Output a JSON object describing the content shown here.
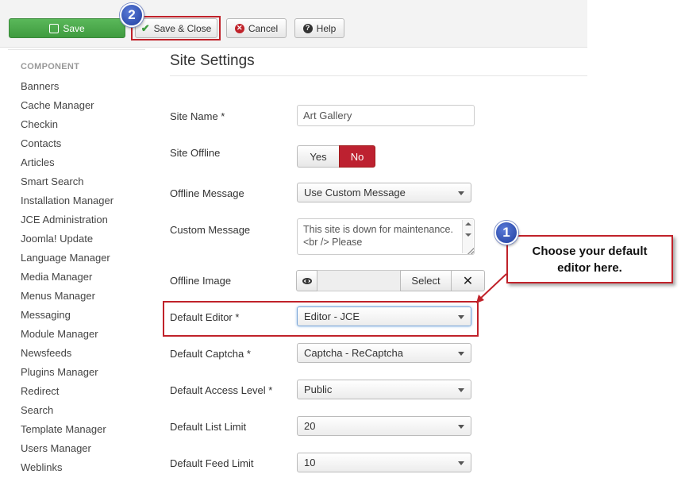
{
  "toolbar": {
    "save_label": "Save",
    "save_close_label": "Save & Close",
    "cancel_label": "Cancel",
    "help_label": "Help"
  },
  "annotations": {
    "badge_1": "1",
    "badge_2": "2",
    "callout_text": "Choose your default editor here."
  },
  "sidebar": {
    "heading": "COMPONENT",
    "items": [
      "Banners",
      "Cache Manager",
      "Checkin",
      "Contacts",
      "Articles",
      "Smart Search",
      "Installation Manager",
      "JCE Administration",
      "Joomla! Update",
      "Language Manager",
      "Media Manager",
      "Menus Manager",
      "Messaging",
      "Module Manager",
      "Newsfeeds",
      "Plugins Manager",
      "Redirect",
      "Search",
      "Template Manager",
      "Users Manager",
      "Weblinks"
    ]
  },
  "main": {
    "title": "Site Settings",
    "site_name": {
      "label": "Site Name *",
      "value": "Art Gallery"
    },
    "site_offline": {
      "label": "Site Offline",
      "yes": "Yes",
      "no": "No"
    },
    "offline_message": {
      "label": "Offline Message",
      "value": "Use Custom Message"
    },
    "custom_message": {
      "label": "Custom Message",
      "value": "This site is down for maintenance.<br /> Please"
    },
    "offline_image": {
      "label": "Offline Image",
      "select_label": "Select",
      "clear_label": "✕"
    },
    "default_editor": {
      "label": "Default Editor *",
      "value": "Editor - JCE"
    },
    "default_captcha": {
      "label": "Default Captcha *",
      "value": "Captcha - ReCaptcha"
    },
    "default_access_level": {
      "label": "Default Access Level *",
      "value": "Public"
    },
    "default_list_limit": {
      "label": "Default List Limit",
      "value": "20"
    },
    "default_feed_limit": {
      "label": "Default Feed Limit",
      "value": "10"
    }
  },
  "colors": {
    "save_green": "#46a546",
    "highlight_red": "#c0222a",
    "toggle_no_red": "#bd2130",
    "badge_blue": "#2b4fb8"
  }
}
